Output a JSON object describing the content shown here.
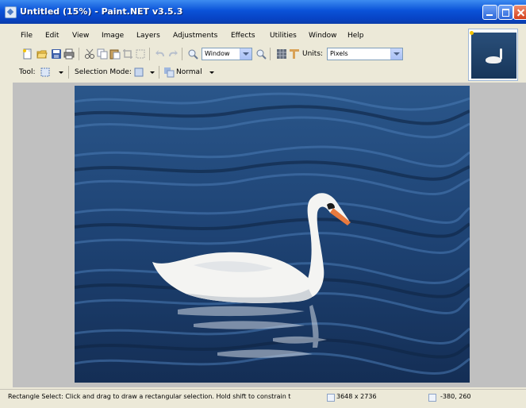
{
  "window": {
    "title": "Untitled (15%) - Paint.NET v3.5.3"
  },
  "menu": [
    "File",
    "Edit",
    "View",
    "Image",
    "Layers",
    "Adjustments",
    "Effects",
    "Utilities",
    "Window",
    "Help"
  ],
  "toolbar": {
    "zoom_value": "Window",
    "units_label": "Units:",
    "units_value": "Pixels"
  },
  "toolbar2": {
    "tool_label": "Tool:",
    "selection_mode_label": "Selection Mode:",
    "blend_value": "Normal"
  },
  "status": {
    "message": "Rectangle Select: Click and drag to draw a rectangular selection. Hold shift to constrain t",
    "image_size": "3648 x 2736",
    "cursor_position": "-380, 260"
  },
  "colors": {
    "title_blue": "#0a52d8",
    "water": "#1c3a66",
    "canvas_bg": "#c0c0c0"
  },
  "icons": {
    "new": "new-file-icon",
    "open": "open-folder-icon",
    "save": "save-icon",
    "print": "print-icon",
    "cut": "cut-icon",
    "copy": "copy-icon",
    "paste": "paste-icon",
    "undo": "undo-icon",
    "redo": "redo-icon",
    "zoom": "zoom-icon"
  }
}
